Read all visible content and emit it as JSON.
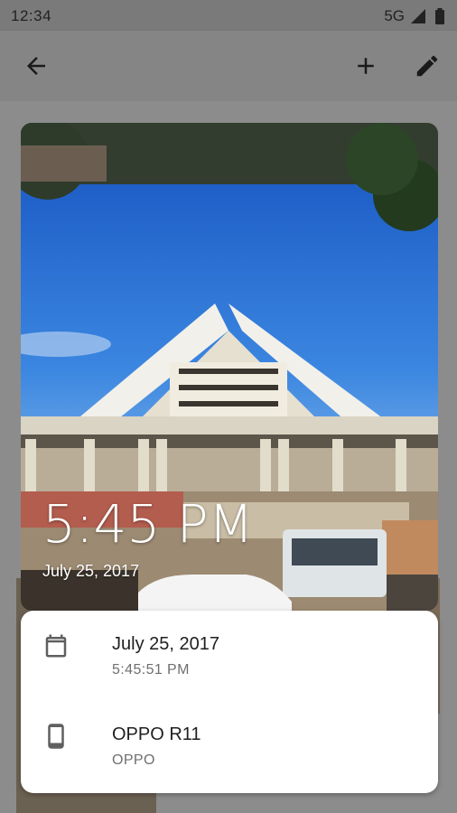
{
  "status_bar": {
    "time": "12:34",
    "network": "5G"
  },
  "app_bar": {
    "icons": [
      "arrow-back-icon",
      "add-icon",
      "edit-icon"
    ]
  },
  "photo": {
    "time_overlay": "5:45 PM",
    "date_overlay": "July 25, 2017"
  },
  "info_panel": {
    "datetime": {
      "icon": "calendar-icon",
      "title": "July 25, 2017",
      "subtitle": "5:45:51 PM"
    },
    "device": {
      "icon": "phone-icon",
      "title": "OPPO R11",
      "subtitle": "OPPO"
    }
  }
}
